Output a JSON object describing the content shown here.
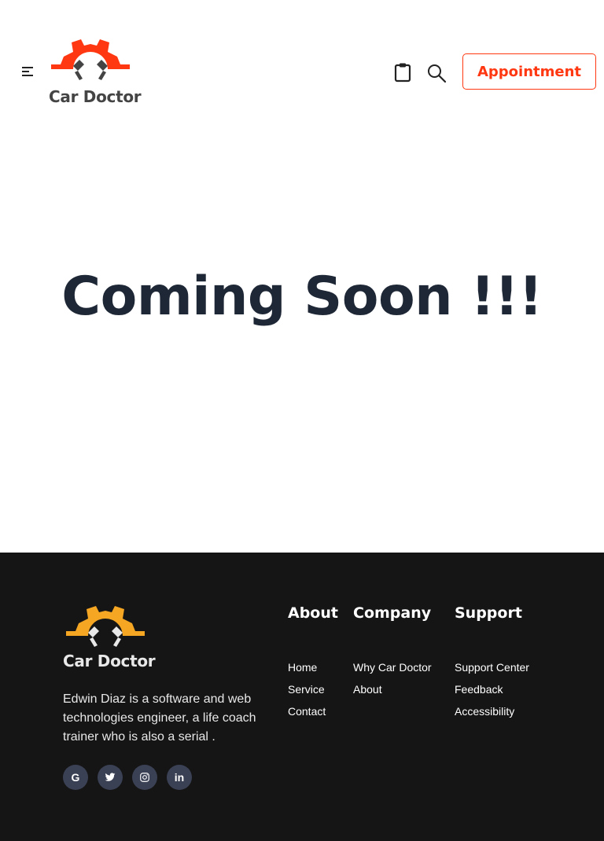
{
  "brand": {
    "name": "Car Doctor",
    "accent_color": "#FF3811",
    "footer_gear_color": "#F5A623"
  },
  "header": {
    "menu_icon": "hamburger-menu-icon",
    "cart_icon": "clipboard-icon",
    "search_icon": "search-icon",
    "appointment_label": "Appointment"
  },
  "main": {
    "title": "Coming Soon !!!"
  },
  "footer": {
    "brand_name": "Car Doctor",
    "description": "Edwin Diaz is a software and web technologies engineer, a life coach trainer who is also a serial .",
    "socials": [
      {
        "icon": "google-icon",
        "glyph": "G"
      },
      {
        "icon": "twitter-icon",
        "glyph": "t"
      },
      {
        "icon": "instagram-icon",
        "glyph": "◎"
      },
      {
        "icon": "linkedin-icon",
        "glyph": "in"
      }
    ],
    "columns": [
      {
        "title": "About",
        "links": [
          "Home",
          "Service",
          "Contact"
        ]
      },
      {
        "title": "Company",
        "links": [
          "Why Car Doctor",
          "About"
        ]
      },
      {
        "title": "Support",
        "links": [
          "Support Center",
          "Feedback",
          "Accessibility"
        ]
      }
    ]
  }
}
